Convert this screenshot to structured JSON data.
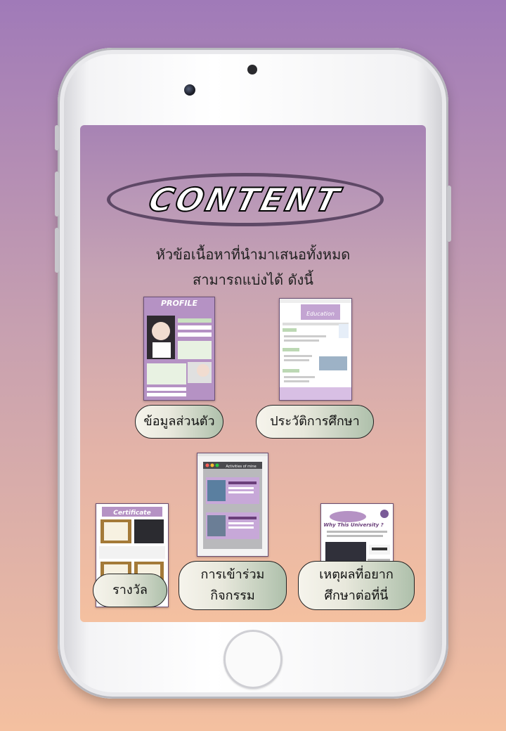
{
  "screen": {
    "title": "CONTENT",
    "subtitle_line1": "หัวข้อเนื้อหาที่นำมาเสนอทั้งหมด",
    "subtitle_line2": "สามารถแบ่งได้ ดังนี้"
  },
  "cards": [
    {
      "label": "ข้อมูลส่วนตัว",
      "thumb_heading": "PROFILE"
    },
    {
      "label": "ประวัติการศึกษา",
      "thumb_heading": "Education"
    },
    {
      "label": "รางวัล",
      "thumb_heading": "Certificate"
    },
    {
      "label_line1": "การเข้าร่วม",
      "label_line2": "กิจกรรม",
      "thumb_heading": "Activities of mine"
    },
    {
      "label_line1": "เหตุผลที่อยาก",
      "label_line2": "ศึกษาต่อที่นี่",
      "thumb_heading": "Why This University ?"
    }
  ]
}
